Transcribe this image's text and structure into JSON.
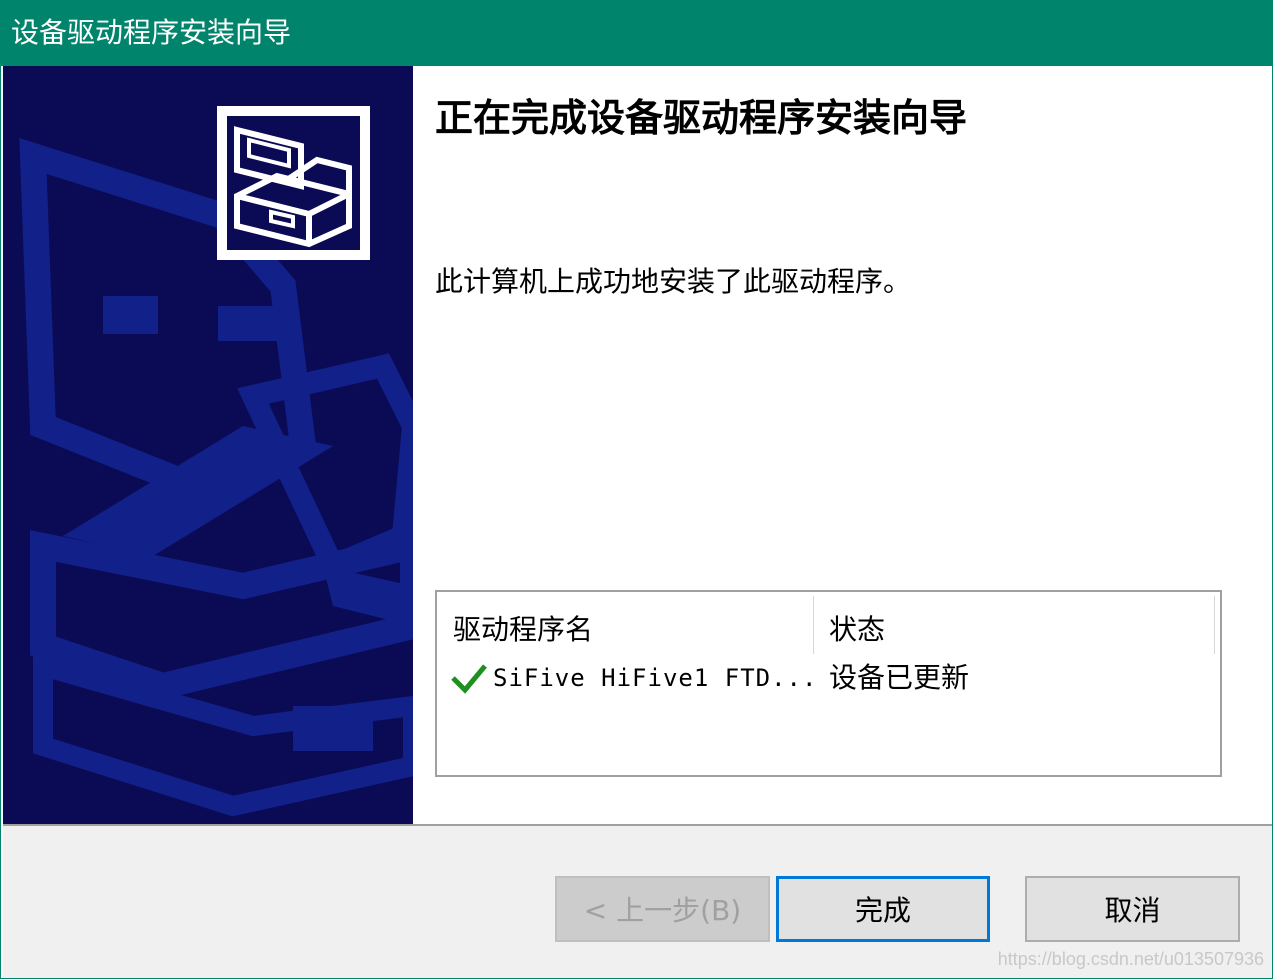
{
  "window": {
    "title": "设备驱动程序安装向导"
  },
  "content": {
    "heading": "正在完成设备驱动程序安装向导",
    "message": "此计算机上成功地安装了此驱动程序。"
  },
  "driver_list": {
    "columns": [
      "驱动程序名",
      "状态"
    ],
    "rows": [
      {
        "icon": "green-checkmark-icon",
        "name": "SiFive HiFive1 FTD...",
        "status": "设备已更新"
      }
    ]
  },
  "buttons": {
    "back_label": "< 上一步(B)",
    "finish_label": "完成",
    "cancel_label": "取消"
  },
  "watermark": "https://blog.csdn.net/u013507936",
  "colors": {
    "titlebar": "#00846c",
    "banner": "#0b0b55",
    "check": "#1f8f1f",
    "focus": "#0078d7"
  }
}
